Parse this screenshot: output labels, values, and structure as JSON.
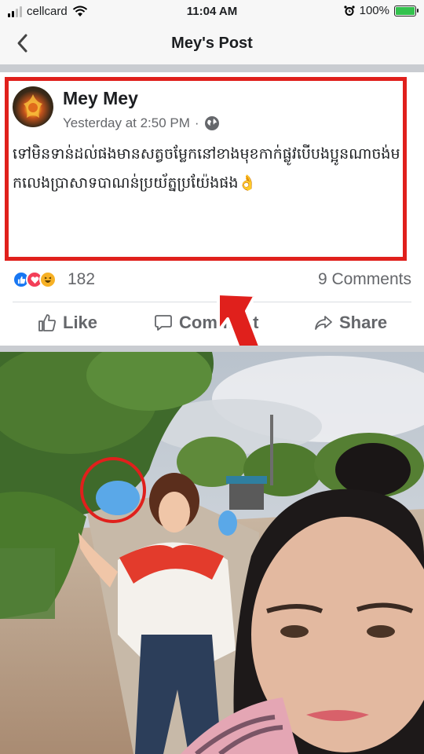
{
  "status_bar": {
    "carrier": "cellcard",
    "time": "11:04 AM",
    "battery": "100%"
  },
  "header": {
    "title": "Mey's Post"
  },
  "post": {
    "author": "Mey Mey",
    "timestamp": "Yesterday at 2:50 PM",
    "separator": "·",
    "text": "ទៅមិនទាន់ដល់ផងមានសត្វចម្លែកនៅខាងមុខកាក់ផ្លូវបើបងប្អូនណាចង់មកលេងប្រាសាទបាណន់ប្រយ័ត្នប្រយ៉ែងផង👌",
    "reaction_count": "182",
    "comments_label": "9 Comments"
  },
  "actions": {
    "like": "Like",
    "comment": "Comment",
    "share": "Share"
  },
  "colors": {
    "highlight": "#e0201c",
    "like_blue": "#1877f2",
    "love_red": "#f33e58",
    "haha_yellow": "#f7b125"
  }
}
